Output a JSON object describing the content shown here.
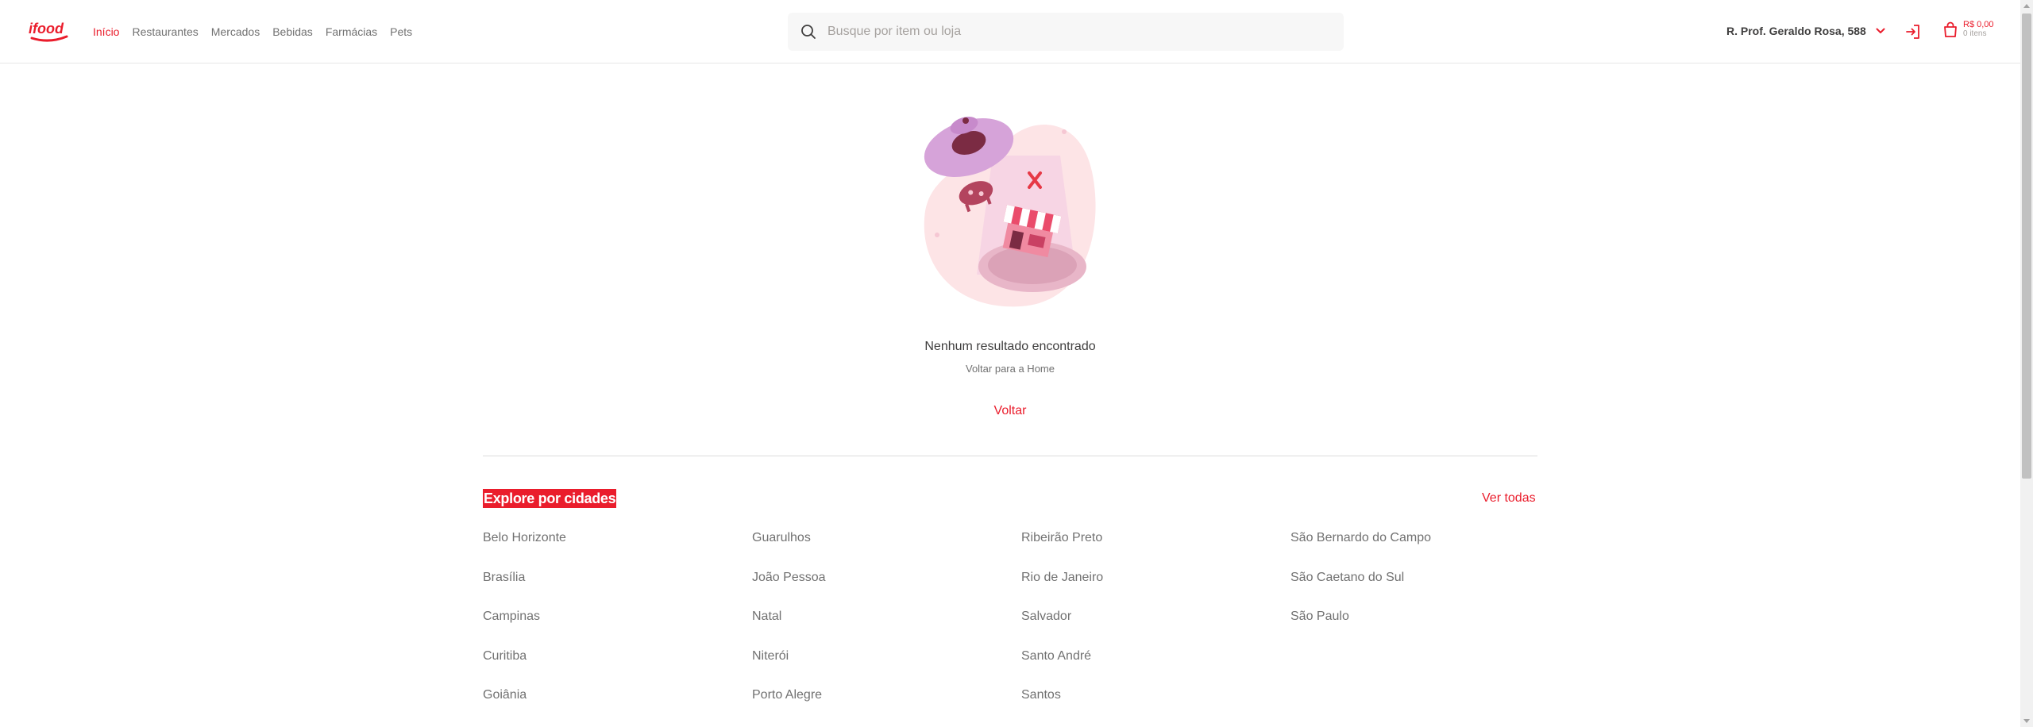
{
  "brand": {
    "logo_text": "ifood",
    "accent": "#ea1d2c"
  },
  "nav": {
    "items": [
      {
        "label": "Início",
        "active": true
      },
      {
        "label": "Restaurantes",
        "active": false
      },
      {
        "label": "Mercados",
        "active": false
      },
      {
        "label": "Bebidas",
        "active": false
      },
      {
        "label": "Farmácias",
        "active": false
      },
      {
        "label": "Pets",
        "active": false
      }
    ]
  },
  "search": {
    "placeholder": "Busque por item ou loja",
    "value": ""
  },
  "address": {
    "label": "R. Prof. Geraldo Rosa, 588"
  },
  "cart": {
    "price": "R$ 0,00",
    "items": "0 itens"
  },
  "empty_state": {
    "title": "Nenhum resultado encontrado",
    "subtitle": "Voltar para a Home",
    "button_label": "Voltar"
  },
  "cities_section": {
    "title": "Explore por cidades",
    "see_all": "Ver todas",
    "cities": [
      "Belo Horizonte",
      "Guarulhos",
      "Ribeirão Preto",
      "São Bernardo do Campo",
      "Brasília",
      "João Pessoa",
      "Rio de Janeiro",
      "São Caetano do Sul",
      "Campinas",
      "Natal",
      "Salvador",
      "São Paulo",
      "Curitiba",
      "Niterói",
      "Santo André",
      "",
      "Goiânia",
      "Porto Alegre",
      "Santos",
      ""
    ]
  },
  "icons": {
    "search": "search-icon",
    "chevron": "chevron-down-icon",
    "login": "login-icon",
    "bag": "shopping-bag-icon"
  }
}
